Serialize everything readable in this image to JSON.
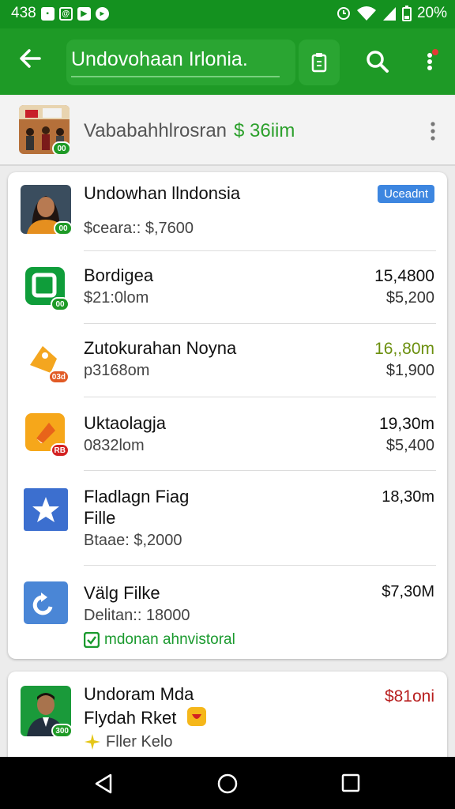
{
  "status_bar": {
    "time": "438",
    "battery": "20%"
  },
  "search": {
    "value": "Undovohaan Irlonia."
  },
  "summary": {
    "title": "Vababahhlrosran",
    "amount": "$ 36iim",
    "thumb_badge": "00"
  },
  "colors": {
    "primary_green": "#1e9a26",
    "status_green": "#14911f",
    "tag_blue": "#3d86e0",
    "amount_red": "#b81f1f",
    "amount_olive": "#6b8f0e"
  },
  "main_card": {
    "header": {
      "title": "Undowhan llndonsia",
      "subtitle": "$ceara:: $,7600",
      "tag": "Uceadnt",
      "avatar_badge": "00"
    },
    "items": [
      {
        "icon": "green-chat-icon",
        "badge": "00",
        "title": "Bordigea",
        "subtitle": "$21:0lom",
        "value1": "15,4800",
        "value2": "$5,200"
      },
      {
        "icon": "orange-tag-icon",
        "badge": "03d",
        "title": "Zutokurahan Noyna",
        "subtitle": "p3168om",
        "value1": "16,,80m",
        "value2": "$1,900"
      },
      {
        "icon": "orange-play-icon",
        "badge": "RB",
        "title": "Uktaolagja",
        "subtitle": "0832lom",
        "value1": "19,30m",
        "value2": "$5,400"
      },
      {
        "icon": "star-icon",
        "title_line1": "Fladlagn Fiag",
        "title_line2": "Fille",
        "subtitle": "Btaae: $,2000",
        "value1": "18,30m"
      },
      {
        "icon": "refresh-icon",
        "title": "Välg Filke",
        "subtitle": "Delitan:: 18000",
        "value1": "$7,30M",
        "check_label": "mdonan ahnvistoral"
      }
    ]
  },
  "second_card": {
    "title_line1": "Undoram Mda",
    "title_line2": "Flydah Rket",
    "subtitle": "Fller Kelo",
    "value": "$81oni",
    "avatar_badge": "300"
  }
}
